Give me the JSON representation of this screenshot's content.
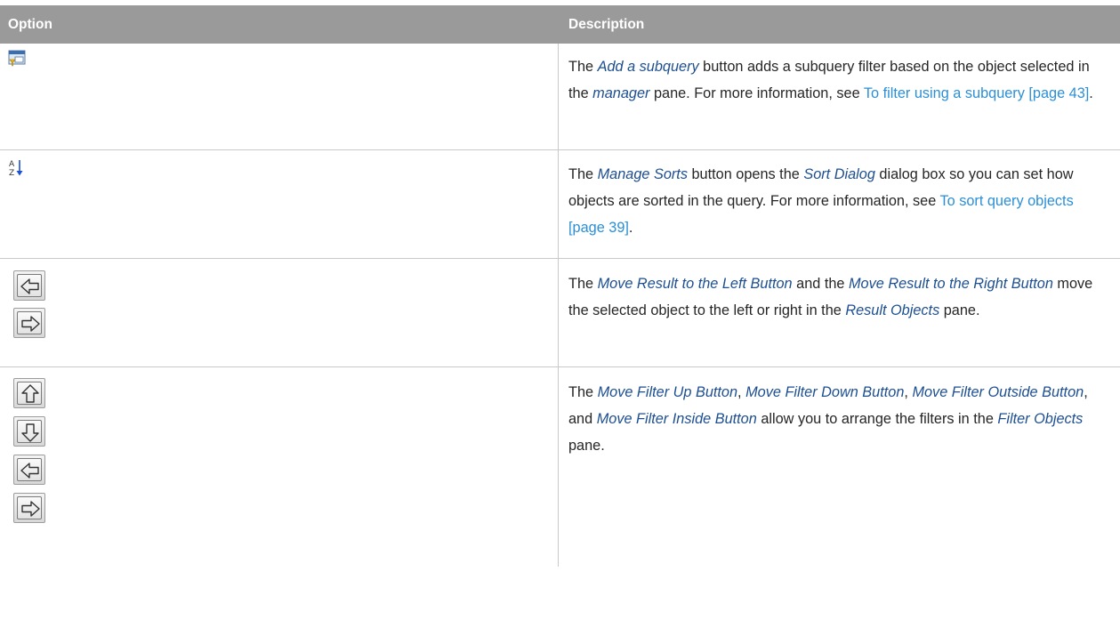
{
  "header": {
    "option": "Option",
    "description": "Description"
  },
  "rows": [
    {
      "icon": "add-subquery-icon",
      "description": [
        {
          "t": "The "
        },
        {
          "t": "Add a subquery",
          "k": "term"
        },
        {
          "t": " button adds a subquery filter based on the object selected in the "
        },
        {
          "t": "manager",
          "k": "term"
        },
        {
          "t": " pane. For more information, see "
        },
        {
          "t": "To filter using a subquery [page 43]",
          "k": "link"
        },
        {
          "t": "."
        }
      ]
    },
    {
      "icon": "sort-az-icon",
      "description": [
        {
          "t": "The "
        },
        {
          "t": "Manage Sorts",
          "k": "term"
        },
        {
          "t": " button opens the "
        },
        {
          "t": "Sort Dialog",
          "k": "term"
        },
        {
          "t": " dialog box so you can set how objects are sorted in the query. For more information, see "
        },
        {
          "t": "To sort query objects [page 39]",
          "k": "link"
        },
        {
          "t": "."
        }
      ]
    },
    {
      "icon": "left-right-arrow-buttons",
      "description": [
        {
          "t": "The "
        },
        {
          "t": "Move Result to the Left Button",
          "k": "term"
        },
        {
          "t": " and the "
        },
        {
          "t": "Move Result to the Right Button",
          "k": "term"
        },
        {
          "t": " move the selected object to the left or right in the "
        },
        {
          "t": "Result Objects",
          "k": "term"
        },
        {
          "t": " pane."
        }
      ]
    },
    {
      "icon": "up-down-left-right-arrow-buttons",
      "description": [
        {
          "t": "The "
        },
        {
          "t": "Move Filter Up Button",
          "k": "term"
        },
        {
          "t": ", "
        },
        {
          "t": "Move Filter Down Button",
          "k": "term"
        },
        {
          "t": ", "
        },
        {
          "t": "Move Filter Outside Button",
          "k": "term"
        },
        {
          "t": ", and "
        },
        {
          "t": "Move Filter Inside Button",
          "k": "term"
        },
        {
          "t": " allow you to arrange the filters in the "
        },
        {
          "t": "Filter Objects",
          "k": "term"
        },
        {
          "t": " pane."
        }
      ]
    }
  ],
  "sort_icon_letters": {
    "top": "A",
    "bottom": "Z"
  },
  "colors": {
    "header_bg": "#9a9a9a",
    "term": "#1d4f91",
    "link": "#2b8fd6",
    "body_text": "#262626"
  }
}
